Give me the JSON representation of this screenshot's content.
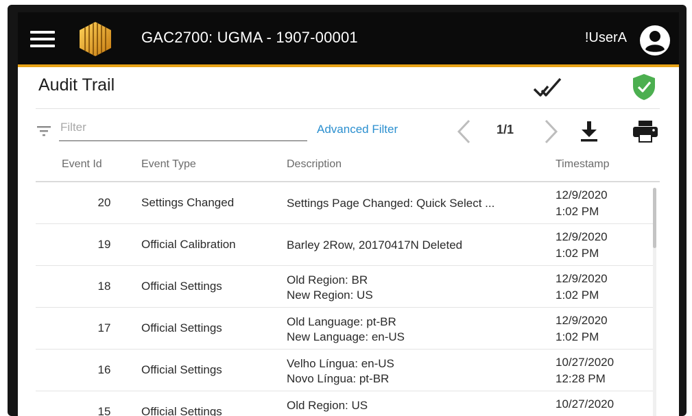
{
  "app": {
    "title": "GAC2700: UGMA - 1907-00001",
    "user": "!UserA",
    "colors": {
      "accent": "#e8a317",
      "appbar": "#0b0b0b",
      "link": "#2b8fcf",
      "verified": "#4caf50"
    }
  },
  "icons": [
    "menu-icon",
    "logo-icon",
    "avatar-icon",
    "check-icon",
    "shield-check-icon",
    "filter-icon",
    "chevron-left-icon",
    "chevron-right-icon",
    "download-icon",
    "print-icon"
  ],
  "page": {
    "title": "Audit Trail"
  },
  "toolbar": {
    "filter_placeholder": "Filter",
    "advanced_filter": "Advanced Filter",
    "page_indicator": "1/1"
  },
  "table": {
    "columns": {
      "id": "Event Id",
      "type": "Event Type",
      "description": "Description",
      "timestamp": "Timestamp"
    },
    "rows": [
      {
        "id": "20",
        "type": "Settings Changed",
        "desc1": "Settings Page Changed: Quick Select ...",
        "desc2": "",
        "date": "12/9/2020",
        "time": "1:02 PM"
      },
      {
        "id": "19",
        "type": "Official Calibration",
        "desc1": "Barley 2Row, 20170417N Deleted",
        "desc2": "",
        "date": "12/9/2020",
        "time": "1:02 PM"
      },
      {
        "id": "18",
        "type": "Official Settings",
        "desc1": "Old  Region: BR",
        "desc2": "New  Region: US",
        "date": "12/9/2020",
        "time": "1:02 PM"
      },
      {
        "id": "17",
        "type": "Official Settings",
        "desc1": "Old  Language: pt-BR",
        "desc2": "New  Language: en-US",
        "date": "12/9/2020",
        "time": "1:02 PM"
      },
      {
        "id": "16",
        "type": "Official Settings",
        "desc1": "Velho Língua: en-US",
        "desc2": "Novo Língua: pt-BR",
        "date": "10/27/2020",
        "time": "12:28 PM"
      },
      {
        "id": "15",
        "type": "Official Settings",
        "desc1": "Old  Region: US",
        "desc2": "",
        "date": "10/27/2020",
        "time": ""
      }
    ]
  }
}
